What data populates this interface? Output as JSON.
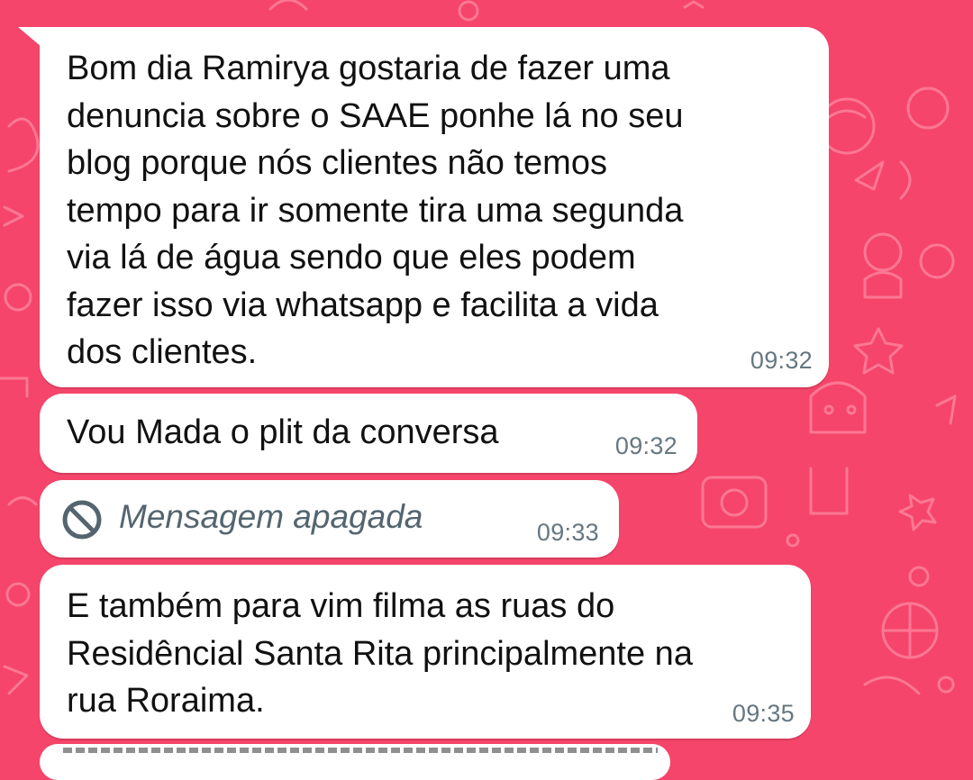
{
  "conversation": {
    "messages": [
      {
        "text": "Bom dia Ramirya gostaria de fazer uma\ndenuncia sobre o SAAE ponhe lá no seu\nblog porque nós clientes não temos\ntempo para ir somente tira uma segunda\nvia lá de água sendo que eles podem\nfazer isso via whatsapp e facilita a vida\ndos clientes.",
        "time": "09:32"
      },
      {
        "text": "Vou Mada o plit da conversa",
        "time": "09:32"
      },
      {
        "text": "Mensagem apagada",
        "time": "09:33",
        "icon": "deleted-message-icon"
      },
      {
        "text": "E também para vim filma as ruas do\nResidêncial Santa Rita principalmente na\nrua Roraima.",
        "time": "09:35"
      }
    ]
  },
  "theme": {
    "wallpaper_color": "#f5456a",
    "bubble_color": "#ffffff",
    "time_color": "#667781",
    "deleted_text_color": "#54656f"
  }
}
